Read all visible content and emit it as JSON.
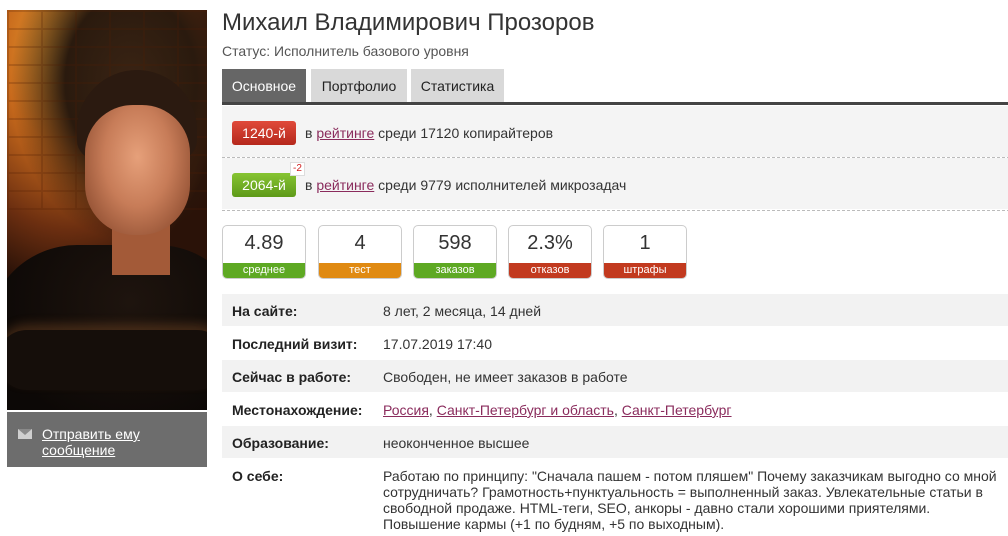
{
  "profile": {
    "name": "Михаил Владимирович Прозоров",
    "status": "Статус: Исполнитель базового уровня",
    "send_message": "Отправить ему сообщение"
  },
  "tabs": [
    {
      "label": "Основное",
      "active": true
    },
    {
      "label": "Портфолио",
      "active": false
    },
    {
      "label": "Статистика",
      "active": false
    }
  ],
  "ratings": [
    {
      "badge": "1240-й",
      "prefix": "в",
      "link": "рейтинге",
      "suffix": "среди 17120 копирайтеров",
      "color": "#d2382a",
      "delta": ""
    },
    {
      "badge": "2064-й",
      "prefix": "в",
      "link": "рейтинге",
      "suffix": "среди 9779 исполнителей микрозадач",
      "color": "#72b128",
      "delta": "-2"
    }
  ],
  "stats": [
    {
      "value": "4.89",
      "label": "среднее",
      "color": "green"
    },
    {
      "value": "4",
      "label": "тест",
      "color": "orange"
    },
    {
      "value": "598",
      "label": "заказов",
      "color": "green"
    },
    {
      "value": "2.3%",
      "label": "отказов",
      "color": "red"
    },
    {
      "value": "1",
      "label": "штрафы",
      "color": "red"
    }
  ],
  "info": {
    "on_site_label": "На сайте:",
    "on_site_value": "8 лет, 2 месяца, 14 дней",
    "last_visit_label": "Последний визит:",
    "last_visit_value": "17.07.2019 17:40",
    "working_label": "Сейчас в работе:",
    "working_value": "Свободен, не имеет заказов в работе",
    "location_label": "Местонахождение:",
    "location_country": "Россия",
    "location_region": "Санкт-Петербург и область",
    "location_city": "Санкт-Петербург",
    "education_label": "Образование:",
    "education_value": "неоконченное высшее",
    "about_label": "О себе:",
    "about_value": "Работаю по принципу: \"Сначала пашем - потом пляшем\" Почему заказчикам выгодно со мной сотрудничать? Грамотность+пунктуальность = выполненный заказ. Увлекательные статьи в свободной продаже. HTML-теги, SEO, анкоры - давно стали хорошими приятелями. Повышение кармы (+1 по будням, +5 по выходным)."
  }
}
